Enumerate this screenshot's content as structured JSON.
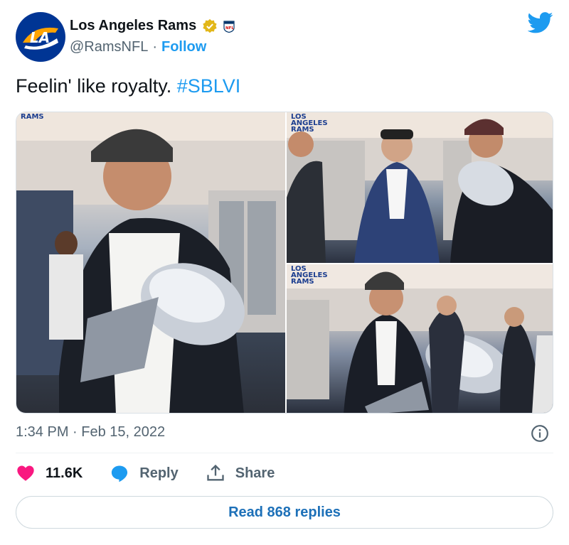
{
  "author": {
    "name": "Los Angeles Rams",
    "handle": "@RamsNFL",
    "separator": "·",
    "follow_label": "Follow",
    "avatar_text": "LA"
  },
  "tweet": {
    "text": "Feelin' like royalty. ",
    "hashtag": "#SBLVI"
  },
  "media": {
    "left_label": "RAMS",
    "tr_label_lines": [
      "LOS",
      "ANGELES",
      "RAMS"
    ],
    "br_label_lines": [
      "LOS",
      "ANGELES",
      "RAMS"
    ]
  },
  "timestamp": "1:34 PM · Feb 15, 2022",
  "actions": {
    "likes": "11.6K",
    "reply_label": "Reply",
    "share_label": "Share"
  },
  "read_replies_label": "Read 868 replies",
  "colors": {
    "link": "#1d9bf0",
    "rams_blue": "#003594",
    "rams_gold": "#ffa300",
    "like_pink": "#f91880"
  },
  "icons": [
    "verified-icon",
    "nfl-badge-icon",
    "twitter-bird-icon",
    "info-icon",
    "heart-icon",
    "reply-icon",
    "share-icon"
  ]
}
